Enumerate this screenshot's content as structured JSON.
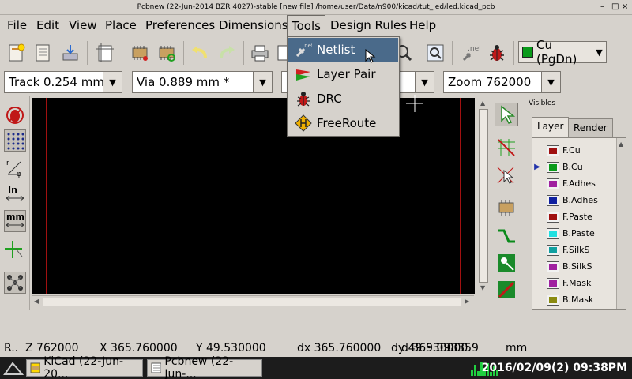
{
  "window": {
    "title": "Pcbnew (22-Jun-2014 BZR 4027)-stable  [new file] /home/user/Data/n900/kicad/tut_led/led.kicad_pcb",
    "controls": [
      "–",
      "□",
      "×"
    ]
  },
  "menubar": {
    "items": [
      "File",
      "Edit",
      "View",
      "Place",
      "Preferences",
      "Dimensions",
      "Tools",
      "Design Rules",
      "Help"
    ],
    "active": "Tools"
  },
  "tools_menu": {
    "items": [
      {
        "label": "Netlist",
        "icon": "netlist-icon",
        "highlighted": true
      },
      {
        "label": "Layer Pair",
        "icon": "layer-pair-icon",
        "highlighted": false
      },
      {
        "label": "DRC",
        "icon": "drc-bug-icon",
        "highlighted": false
      },
      {
        "label": "FreeRoute",
        "icon": "freeroute-icon",
        "highlighted": false
      }
    ]
  },
  "toolbar": {
    "active_layer": "Cu (PgDn)",
    "active_layer_color": "#0a9a1a"
  },
  "selectors": {
    "track": "Track 0.254 mm *",
    "via": "Via 0.889 mm *",
    "zoom": "Zoom 762000"
  },
  "visibles": {
    "title": "Visibles",
    "tabs": [
      "Layer",
      "Render"
    ],
    "selected_tab": "Layer",
    "active_layer": "B.Cu",
    "layers": [
      {
        "name": "F.Cu",
        "color": "#a01010"
      },
      {
        "name": "B.Cu",
        "color": "#0a9a1a"
      },
      {
        "name": "F.Adhes",
        "color": "#a020a0"
      },
      {
        "name": "B.Adhes",
        "color": "#1020a0"
      },
      {
        "name": "F.Paste",
        "color": "#a01010"
      },
      {
        "name": "B.Paste",
        "color": "#20e0e0"
      },
      {
        "name": "F.SilkS",
        "color": "#10a0a0"
      },
      {
        "name": "B.SilkS",
        "color": "#a020a0"
      },
      {
        "name": "F.Mask",
        "color": "#a020a0"
      },
      {
        "name": "B.Mask",
        "color": "#8a8a10"
      }
    ]
  },
  "status": {
    "mode": "R..",
    "z": "Z 762000",
    "x": "X 365.760000",
    "y": "Y 49.530000",
    "dx": "dx 365.760000",
    "dy": "dy 49.530000",
    "d": "d 369.098359",
    "units": "mm"
  },
  "taskbar": {
    "tasks": [
      "KiCad (22-Jun-20...",
      "Pcbnew (22-Jun-..."
    ],
    "clock": "2016/02/09(2) 09:38PM"
  }
}
